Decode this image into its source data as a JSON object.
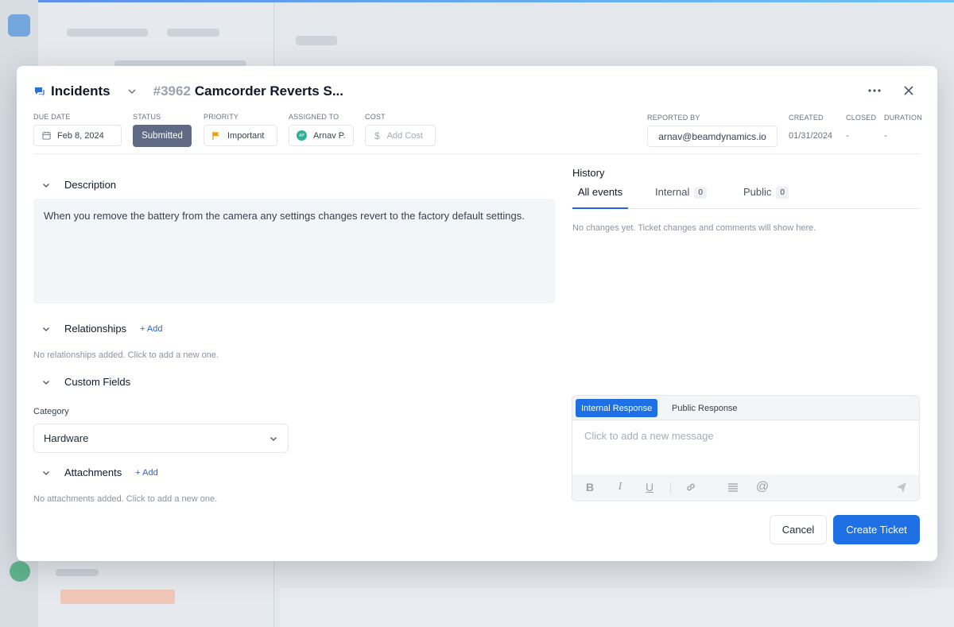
{
  "header": {
    "app_name": "Incidents",
    "ticket_number": "#3962",
    "ticket_title": "Camcorder Reverts S..."
  },
  "fields": {
    "due_date": {
      "label": "DUE DATE",
      "value": "Feb 8, 2024"
    },
    "status": {
      "label": "STATUS",
      "value": "Submitted"
    },
    "priority": {
      "label": "PRIORITY",
      "value": "Important"
    },
    "assigned_to": {
      "label": "ASSIGNED TO",
      "value": "Arnav P.",
      "initials": "AP"
    },
    "cost": {
      "label": "COST",
      "placeholder": "Add Cost"
    },
    "reported_by": {
      "label": "REPORTED BY",
      "value": "arnav@beamdynamics.io"
    },
    "created": {
      "label": "CREATED",
      "value": "01/31/2024"
    },
    "closed": {
      "label": "CLOSED",
      "value": "-"
    },
    "duration": {
      "label": "DURATION",
      "value": "-"
    }
  },
  "description": {
    "title": "Description",
    "text": "When you remove the battery from the camera any settings changes revert to the factory default settings."
  },
  "relationships": {
    "title": "Relationships",
    "add_label": "+ Add",
    "empty": "No relationships added. Click to add a new one."
  },
  "custom_fields": {
    "title": "Custom Fields",
    "category_label": "Category",
    "category_value": "Hardware"
  },
  "attachments": {
    "title": "Attachments",
    "add_label": "+ Add",
    "empty": "No attachments added. Click to add a new one."
  },
  "history": {
    "title": "History",
    "tabs": [
      {
        "label": "All events"
      },
      {
        "label": "Internal",
        "count": "0"
      },
      {
        "label": "Public",
        "count": "0"
      }
    ],
    "empty": "No changes yet. Ticket changes and comments will show here."
  },
  "composer": {
    "tab_internal": "Internal Response",
    "tab_public": "Public Response",
    "placeholder": "Click to add a new message"
  },
  "actions": {
    "cancel": "Cancel",
    "create": "Create Ticket"
  },
  "colors": {
    "accent": "#1f6fe5",
    "status_badge": "#5f6b84",
    "priority_flag": "#f59e0b"
  }
}
